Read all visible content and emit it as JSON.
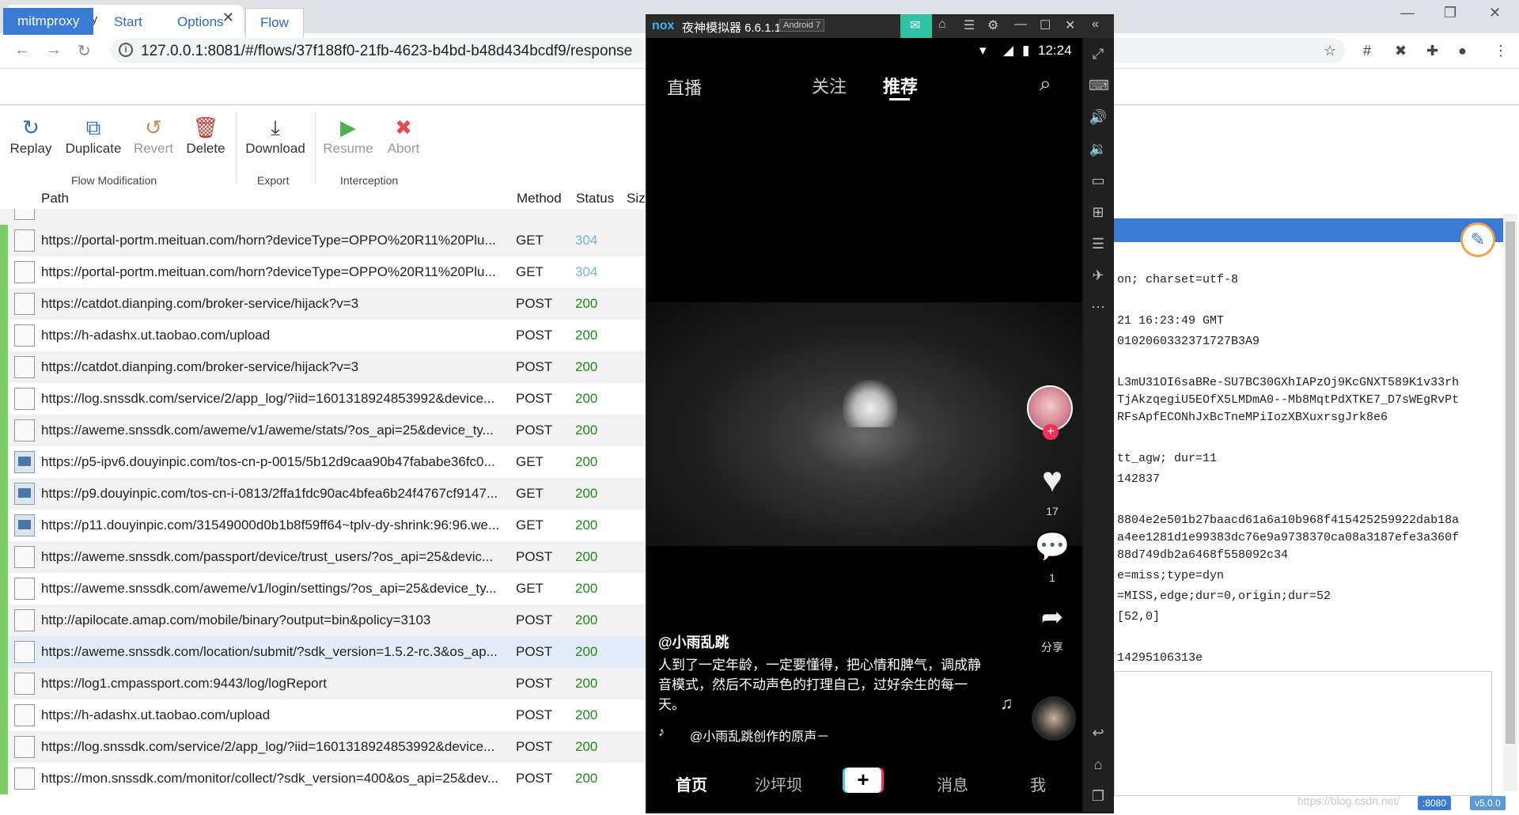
{
  "browser": {
    "tab_title": "mitmproxy",
    "tab_close": "✕",
    "new_tab": "+",
    "url": "127.0.0.1:8081/#/flows/37f188f0-21fb-4623-b4bd-b48d434bcdf9/response",
    "window_controls": [
      "—",
      "❐",
      "✕"
    ]
  },
  "menu": {
    "brand": "mitmproxy",
    "tabs": [
      "Start",
      "Options",
      "Flow"
    ]
  },
  "toolbar": {
    "replay": "Replay",
    "duplicate": "Duplicate",
    "revert": "Revert",
    "delete": "Delete",
    "download": "Download",
    "resume": "Resume",
    "abort": "Abort",
    "group_modification": "Flow Modification",
    "group_export": "Export",
    "group_interception": "Interception"
  },
  "table": {
    "headers": {
      "path": "Path",
      "method": "Method",
      "status": "Status",
      "size": "Size"
    },
    "rows": [
      {
        "path": "https://portal-portm.meituan.com/horn?deviceType=OPPO%20R11%20Plu...",
        "method": "GET",
        "status": "304",
        "icon": "file"
      },
      {
        "path": "https://portal-portm.meituan.com/horn?deviceType=OPPO%20R11%20Plu...",
        "method": "GET",
        "status": "304",
        "icon": "file"
      },
      {
        "path": "https://catdot.dianping.com/broker-service/hijack?v=3",
        "method": "POST",
        "status": "200",
        "icon": "file"
      },
      {
        "path": "https://h-adashx.ut.taobao.com/upload",
        "method": "POST",
        "status": "200",
        "icon": "file"
      },
      {
        "path": "https://catdot.dianping.com/broker-service/hijack?v=3",
        "method": "POST",
        "status": "200",
        "icon": "file"
      },
      {
        "path": "https://log.snssdk.com/service/2/app_log/?iid=1601318924853992&device...",
        "method": "POST",
        "status": "200",
        "icon": "file"
      },
      {
        "path": "https://aweme.snssdk.com/aweme/v1/aweme/stats/?os_api=25&device_ty...",
        "method": "POST",
        "status": "200",
        "icon": "file"
      },
      {
        "path": "https://p5-ipv6.douyinpic.com/tos-cn-p-0015/5b12d9caa90b47fababe36fc0...",
        "method": "GET",
        "status": "200",
        "icon": "image"
      },
      {
        "path": "https://p9.douyinpic.com/tos-cn-i-0813/2ffa1fdc90ac4bfea6b24f4767cf9147...",
        "method": "GET",
        "status": "200",
        "icon": "image"
      },
      {
        "path": "https://p11.douyinpic.com/31549000d0b1b8f59ff64~tplv-dy-shrink:96:96.we...",
        "method": "GET",
        "status": "200",
        "icon": "image"
      },
      {
        "path": "https://aweme.snssdk.com/passport/device/trust_users/?os_api=25&devic...",
        "method": "POST",
        "status": "200",
        "icon": "file"
      },
      {
        "path": "https://aweme.snssdk.com/aweme/v1/login/settings/?os_api=25&device_ty...",
        "method": "GET",
        "status": "200",
        "icon": "file"
      },
      {
        "path": "http://apilocate.amap.com/mobile/binary?output=bin&policy=3103",
        "method": "POST",
        "status": "200",
        "icon": "file"
      },
      {
        "path": "https://aweme.snssdk.com/location/submit/?sdk_version=1.5.2-rc.3&os_ap...",
        "method": "POST",
        "status": "200",
        "icon": "file"
      },
      {
        "path": "https://log1.cmpassport.com:9443/log/logReport",
        "method": "POST",
        "status": "200",
        "icon": "file"
      },
      {
        "path": "https://h-adashx.ut.taobao.com/upload",
        "method": "POST",
        "status": "200",
        "icon": "file"
      },
      {
        "path": "https://log.snssdk.com/service/2/app_log/?iid=1601318924853992&device...",
        "method": "POST",
        "status": "200",
        "icon": "file"
      },
      {
        "path": "https://mon.snssdk.com/monitor/collect/?sdk_version=400&os_api=25&dev...",
        "method": "POST",
        "status": "200",
        "icon": "file"
      }
    ]
  },
  "detail": {
    "lines": [
      "on; charset=utf-8",
      "21 16:23:49 GMT",
      "0102060332371727B3A9",
      "L3mU31OI6saBRe-SU7BC30GXhIAPzOj9KcGNXT589K1v33rh",
      "TjAkzqegiU5EOfX5LMDmA0--Mb8MqtPdXTKE7_D7sWEgRvPt",
      "RFsApfECONhJxBcTneMPiIozXBXuxrsgJrk8e6",
      " tt_agw; dur=11",
      "142837",
      "8804e2e501b27baacd61a6a10b968f415425259922dab18a",
      "a4ee1281d1e99383dc76e9a9738370ca08a3187efe3a360f",
      "88d749db2a6468f558092c34",
      "e=miss;type=dyn",
      "=MISS,edge;dur=0,origin;dur=52",
      "[52,0]",
      "14295106313e"
    ],
    "watermark": "https://blog.csdn.net/",
    "badge_port": ":8080",
    "badge_version": "v5.0.0"
  },
  "nox": {
    "logo": "nox",
    "title": "夜神模拟器 6.6.1.1",
    "android": "Android 7",
    "time": "12:24"
  },
  "app": {
    "live": "直播",
    "tab_follow": "关注",
    "tab_recommend": "推荐",
    "likes": "17",
    "comments": "1",
    "share": "分享",
    "author": "@小雨乱跳",
    "caption": "人到了一定年龄，一定要懂得，把心情和脾气，调成静音模式，然后不动声色的打理自己，过好余生的每一天。",
    "music": "@小雨乱跳创作的原声－",
    "nav": {
      "home": "首页",
      "city": "沙坪坝",
      "messages": "消息",
      "me": "我",
      "plus": "+"
    }
  },
  "colors": {
    "accent": "#3a7bd5",
    "status_ok": "#1c8a1c",
    "status_304": "#7ab0e0",
    "flow_bar": "#7ccc6a"
  }
}
